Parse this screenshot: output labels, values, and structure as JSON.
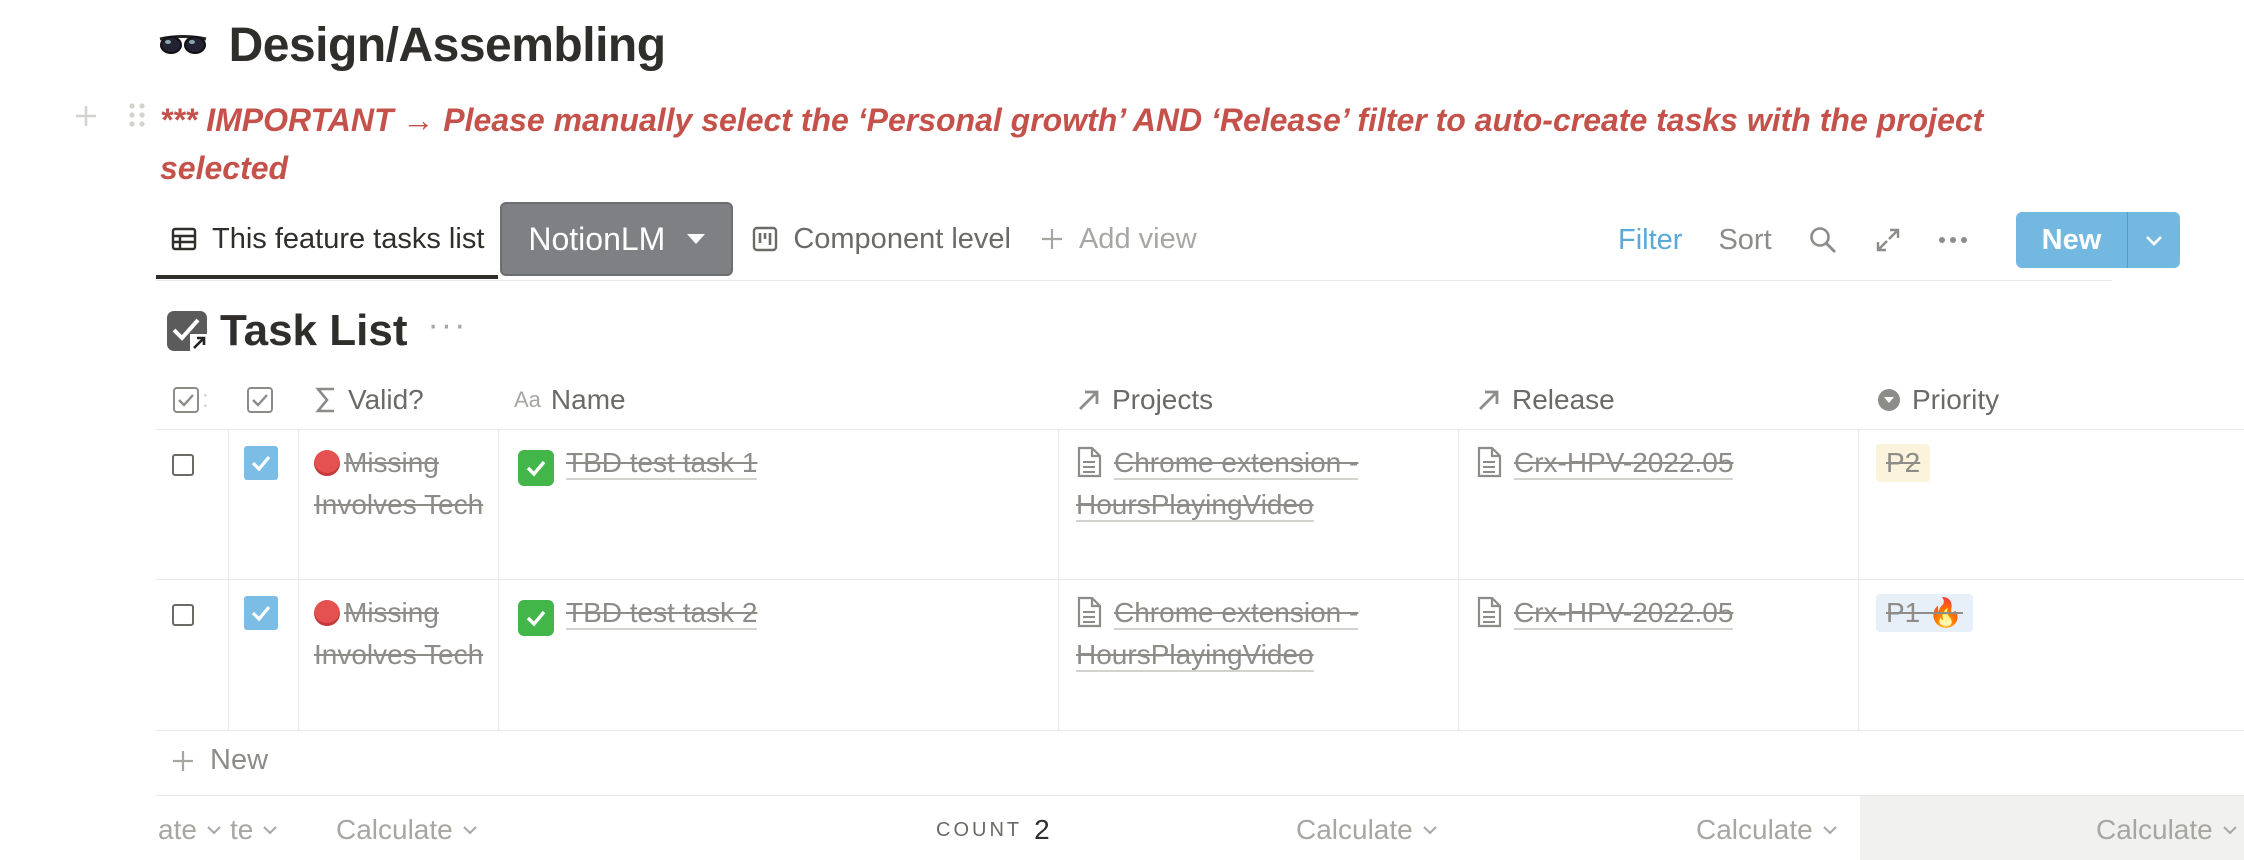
{
  "page": {
    "title": "Design/Assembling",
    "icon": "glasses-icon",
    "note": "*** IMPORTANT → Please manually select the ‘Personal growth’ AND ‘Release’ filter to auto-create tasks with the project selected"
  },
  "views": {
    "tabs": [
      {
        "label": "This feature tasks list",
        "icon": "table-icon",
        "active": true
      },
      {
        "label": "NotionLM",
        "icon": "caret-down-icon",
        "overlay": true
      },
      {
        "label": "Component level",
        "icon": "board-icon"
      },
      {
        "label": "Add view",
        "icon": "plus-icon"
      }
    ]
  },
  "toolbar": {
    "filter": "Filter",
    "sort": "Sort",
    "new": "New"
  },
  "database": {
    "title": "Task List",
    "icon": "checkbox-link-icon",
    "columns": {
      "valid": "Valid?",
      "name": "Name",
      "projects": "Projects",
      "release": "Release",
      "priority": "Priority"
    },
    "rows": [
      {
        "selected": false,
        "done": true,
        "valid": "Missing Involves Tech",
        "name": "TBD test task 1",
        "project": "Chrome extension - HoursPlayingVideo",
        "release": "Crx-HPV-2022.05",
        "priority": "P2"
      },
      {
        "selected": false,
        "done": true,
        "valid": "Missing Involves Tech",
        "name": "TBD test task 2",
        "project": "Chrome extension - HoursPlayingVideo",
        "release": "Crx-HPV-2022.05",
        "priority": "P1 🔥"
      }
    ],
    "new_row": "New",
    "footer": {
      "col1": "ate",
      "col2": "te",
      "col3": "Calculate",
      "count_label": "COUNT",
      "count_value": "2",
      "col5": "Calculate",
      "col6": "Calculate",
      "col7": "Calculate"
    }
  },
  "colors": {
    "accent": "#73b8e0",
    "note_red": "#c4514a",
    "filter_blue": "#5aa9d7"
  }
}
